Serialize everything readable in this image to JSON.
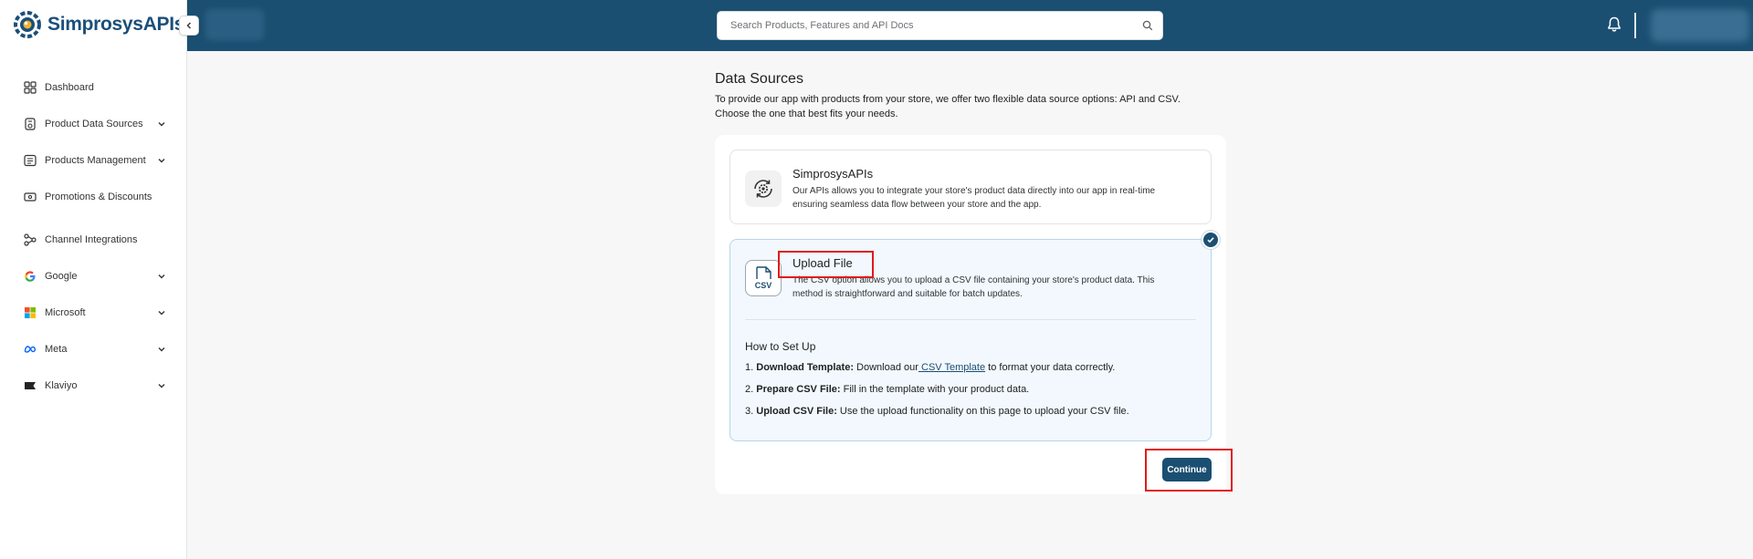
{
  "brand": {
    "name_part1": "Simprosys",
    "name_part2": "APIs"
  },
  "search": {
    "placeholder": "Search Products, Features and API Docs"
  },
  "sidebar": {
    "items": [
      {
        "label": "Dashboard",
        "icon": "dashboard-icon",
        "has_chevron": false
      },
      {
        "label": "Product Data Sources",
        "icon": "data-sources-icon",
        "has_chevron": true
      },
      {
        "label": "Products Management",
        "icon": "products-icon",
        "has_chevron": true
      },
      {
        "label": "Promotions & Discounts",
        "icon": "promotions-icon",
        "has_chevron": false
      },
      {
        "label": "Channel Integrations",
        "icon": "integrations-icon",
        "has_chevron": false
      },
      {
        "label": "Google",
        "icon": "google-icon",
        "has_chevron": true
      },
      {
        "label": "Microsoft",
        "icon": "microsoft-icon",
        "has_chevron": true
      },
      {
        "label": "Meta",
        "icon": "meta-icon",
        "has_chevron": true
      },
      {
        "label": "Klaviyo",
        "icon": "klaviyo-icon",
        "has_chevron": true
      }
    ]
  },
  "page": {
    "title": "Data Sources",
    "description_line1": "To provide our app with products from your store, we offer two flexible data source options: API and CSV.",
    "description_line2": "Choose the one that best fits your needs."
  },
  "options": {
    "api": {
      "title": "SimprosysAPIs",
      "desc_line1": "Our APIs allows you to integrate your store's product data directly into our app in real-time",
      "desc_line2": "ensuring seamless data flow between your store and the app."
    },
    "csv": {
      "title": "Upload File",
      "icon_text": "CSV",
      "desc_line1": "The CSV option allows you to upload a CSV file containing your store's product data. This",
      "desc_line2": "method is straightforward and suitable for batch updates.",
      "setup_title": "How to Set Up",
      "steps": [
        {
          "num": "1.",
          "bold": "Download Template:",
          "text_before": " Download our",
          "link": " CSV Template",
          "text_after": " to format your data correctly."
        },
        {
          "num": "2.",
          "bold": "Prepare CSV File:",
          "text_before": " Fill in the template with your product data.",
          "link": "",
          "text_after": ""
        },
        {
          "num": "3.",
          "bold": "Upload CSV File:",
          "text_before": " Use the upload functionality on this page to upload your CSV file.",
          "link": "",
          "text_after": ""
        }
      ]
    }
  },
  "actions": {
    "continue_label": "Continue"
  },
  "colors": {
    "primary": "#1b4f72",
    "highlight": "#e01b1b"
  }
}
